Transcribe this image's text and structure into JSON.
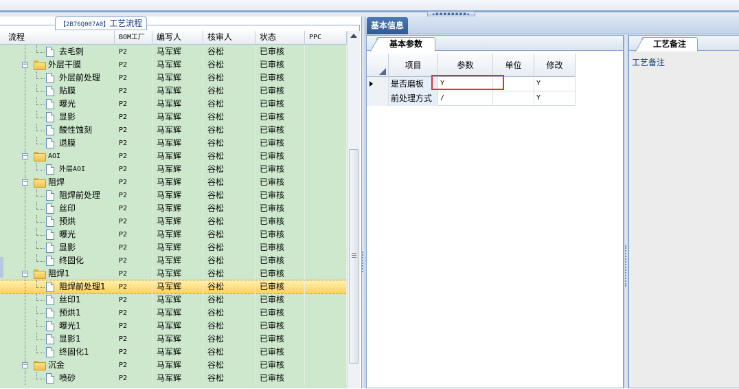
{
  "window": {
    "splitter_glyph": "▴▪▪▪▪▪▪▪▪▴"
  },
  "left_panel": {
    "tab": {
      "code": "【2B76Q007A0】",
      "title": "工艺流程"
    },
    "columns": [
      "流程",
      "BOM工厂",
      "编写人",
      "核审人",
      "状态",
      "PPC"
    ],
    "rows": [
      {
        "level": 2,
        "type": "doc",
        "name": "去毛刺",
        "bom": "P2",
        "writer": "马军辉",
        "reviewer": "谷松",
        "status": "已审核",
        "ppc": ""
      },
      {
        "level": 1,
        "type": "folder",
        "name": "外层干膜",
        "bom": "P2",
        "writer": "马军辉",
        "reviewer": "谷松",
        "status": "已审核",
        "ppc": ""
      },
      {
        "level": 2,
        "type": "doc",
        "name": "外层前处理",
        "bom": "P2",
        "writer": "马军辉",
        "reviewer": "谷松",
        "status": "已审核",
        "ppc": ""
      },
      {
        "level": 2,
        "type": "doc",
        "name": "贴膜",
        "bom": "P2",
        "writer": "马军辉",
        "reviewer": "谷松",
        "status": "已审核",
        "ppc": ""
      },
      {
        "level": 2,
        "type": "doc",
        "name": "曝光",
        "bom": "P2",
        "writer": "马军辉",
        "reviewer": "谷松",
        "status": "已审核",
        "ppc": ""
      },
      {
        "level": 2,
        "type": "doc",
        "name": "显影",
        "bom": "P2",
        "writer": "马军辉",
        "reviewer": "谷松",
        "status": "已审核",
        "ppc": ""
      },
      {
        "level": 2,
        "type": "doc",
        "name": "酸性蚀刻",
        "bom": "P2",
        "writer": "马军辉",
        "reviewer": "谷松",
        "status": "已审核",
        "ppc": ""
      },
      {
        "level": 2,
        "type": "doc",
        "name": "退膜",
        "bom": "P2",
        "writer": "马军辉",
        "reviewer": "谷松",
        "status": "已审核",
        "ppc": ""
      },
      {
        "level": 1,
        "type": "folder",
        "name": "AOI",
        "bom": "P2",
        "writer": "马军辉",
        "reviewer": "谷松",
        "status": "已审核",
        "ppc": ""
      },
      {
        "level": 2,
        "type": "doc",
        "name": "外层AOI",
        "bom": "P2",
        "writer": "马军辉",
        "reviewer": "谷松",
        "status": "已审核",
        "ppc": ""
      },
      {
        "level": 1,
        "type": "folder",
        "name": "阻焊",
        "bom": "P2",
        "writer": "马军辉",
        "reviewer": "谷松",
        "status": "已审核",
        "ppc": ""
      },
      {
        "level": 2,
        "type": "doc",
        "name": "阻焊前处理",
        "bom": "P2",
        "writer": "马军辉",
        "reviewer": "谷松",
        "status": "已审核",
        "ppc": ""
      },
      {
        "level": 2,
        "type": "doc",
        "name": "丝印",
        "bom": "P2",
        "writer": "马军辉",
        "reviewer": "谷松",
        "status": "已审核",
        "ppc": ""
      },
      {
        "level": 2,
        "type": "doc",
        "name": "预烘",
        "bom": "P2",
        "writer": "马军辉",
        "reviewer": "谷松",
        "status": "已审核",
        "ppc": ""
      },
      {
        "level": 2,
        "type": "doc",
        "name": "曝光",
        "bom": "P2",
        "writer": "马军辉",
        "reviewer": "谷松",
        "status": "已审核",
        "ppc": ""
      },
      {
        "level": 2,
        "type": "doc",
        "name": "显影",
        "bom": "P2",
        "writer": "马军辉",
        "reviewer": "谷松",
        "status": "已审核",
        "ppc": ""
      },
      {
        "level": 2,
        "type": "doc",
        "name": "终固化",
        "bom": "P2",
        "writer": "马军辉",
        "reviewer": "谷松",
        "status": "已审核",
        "ppc": ""
      },
      {
        "level": 1,
        "type": "folder",
        "name": "阻焊1",
        "bom": "P2",
        "writer": "马军辉",
        "reviewer": "谷松",
        "status": "已审核",
        "ppc": ""
      },
      {
        "level": 2,
        "type": "doc",
        "name": "阻焊前处理1",
        "bom": "P2",
        "writer": "马军辉",
        "reviewer": "谷松",
        "status": "已审核",
        "ppc": "",
        "selected": true
      },
      {
        "level": 2,
        "type": "doc",
        "name": "丝印1",
        "bom": "P2",
        "writer": "马军辉",
        "reviewer": "谷松",
        "status": "已审核",
        "ppc": ""
      },
      {
        "level": 2,
        "type": "doc",
        "name": "预烘1",
        "bom": "P2",
        "writer": "马军辉",
        "reviewer": "谷松",
        "status": "已审核",
        "ppc": ""
      },
      {
        "level": 2,
        "type": "doc",
        "name": "曝光1",
        "bom": "P2",
        "writer": "马军辉",
        "reviewer": "谷松",
        "status": "已审核",
        "ppc": ""
      },
      {
        "level": 2,
        "type": "doc",
        "name": "显影1",
        "bom": "P2",
        "writer": "马军辉",
        "reviewer": "谷松",
        "status": "已审核",
        "ppc": ""
      },
      {
        "level": 2,
        "type": "doc",
        "name": "终固化1",
        "bom": "P2",
        "writer": "马军辉",
        "reviewer": "谷松",
        "status": "已审核",
        "ppc": ""
      },
      {
        "level": 1,
        "type": "folder",
        "name": "沉金",
        "bom": "P2",
        "writer": "马军辉",
        "reviewer": "谷松",
        "status": "已审核",
        "ppc": ""
      },
      {
        "level": 2,
        "type": "doc",
        "name": "喷砂",
        "bom": "P2",
        "writer": "马军辉",
        "reviewer": "谷松",
        "status": "已审核",
        "ppc": ""
      }
    ]
  },
  "right_panel": {
    "main_tab": "基本信息",
    "params_tab": "基本参数",
    "grid_columns": [
      "项目",
      "参数",
      "单位",
      "修改"
    ],
    "grid_rows": [
      {
        "item": "是否磨板",
        "param": "Y",
        "unit": "",
        "modify": "Y",
        "current": true
      },
      {
        "item": "前处理方式",
        "param": "/",
        "unit": "",
        "modify": "Y",
        "current": false
      }
    ],
    "notes_tab": "工艺备注",
    "notes_label": "工艺备注"
  },
  "colors": {
    "tree_bg": "#cde8cd",
    "selected_row": "#ffd25c",
    "highlight_box": "#d8322c",
    "accent": "#2f5a97"
  }
}
